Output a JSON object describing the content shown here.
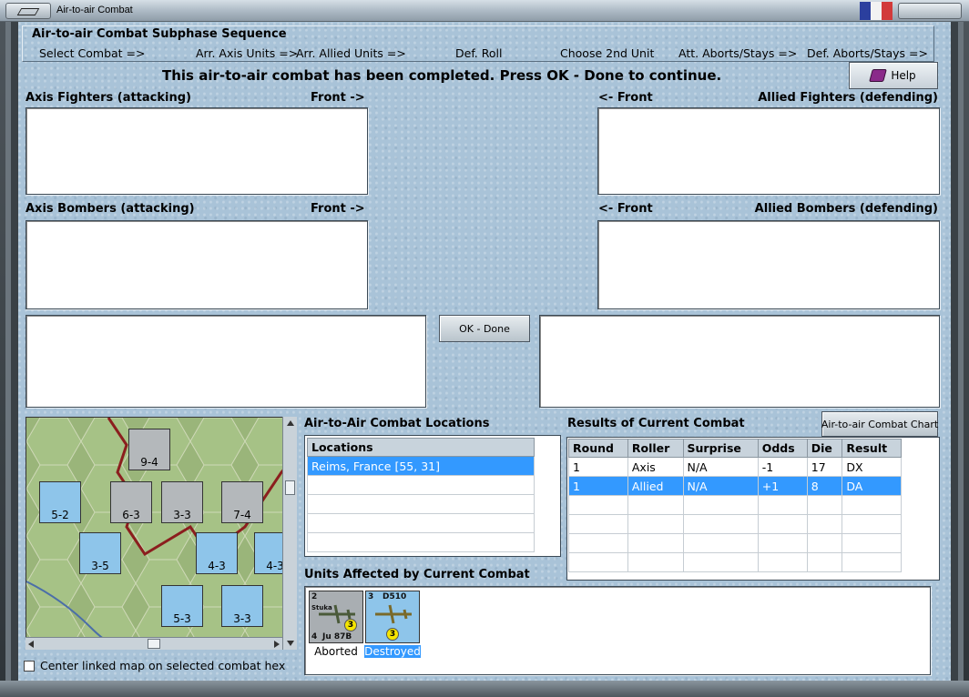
{
  "window": {
    "title": "Air-to-air Combat",
    "flag_colors": [
      "#2b3f9e",
      "#f2f2f2",
      "#d23a3a"
    ]
  },
  "sequence": {
    "title": "Air-to-air Combat Subphase Sequence",
    "steps": [
      "Select Combat =>",
      "Arr. Axis Units =>",
      "Arr. Allied Units =>",
      "Def. Roll",
      "Choose 2nd Unit",
      "Att. Aborts/Stays =>",
      "Def. Aborts/Stays =>"
    ]
  },
  "status_message": "This air-to-air combat has been completed.  Press OK - Done to continue.",
  "help_label": "Help",
  "boxes": {
    "axis_fighters": "Axis Fighters (attacking)",
    "allied_fighters": "Allied Fighters (defending)",
    "axis_bombers": "Axis Bombers (attacking)",
    "allied_bombers": "Allied Bombers (defending)",
    "front_right": "Front ->",
    "front_left": "<- Front"
  },
  "ok_label": "OK - Done",
  "locations": {
    "title": "Air-to-Air Combat Locations",
    "header": "Locations",
    "rows": [
      "Reims, France [55, 31]"
    ]
  },
  "results": {
    "title": "Results of Current Combat",
    "chart_button": "Air-to-air Combat Chart",
    "headers": [
      "Round",
      "Roller",
      "Surprise",
      "Odds",
      "Die",
      "Result"
    ],
    "rows": [
      [
        "1",
        "Axis",
        "N/A",
        "-1",
        "17",
        "DX"
      ],
      [
        "1",
        "Allied",
        "N/A",
        "+1",
        "8",
        "DA"
      ]
    ]
  },
  "units_affected": {
    "title": "Units Affected by Current Combat",
    "units": [
      {
        "top_left": "2",
        "name": "Ju 87B",
        "sub": "Stuka",
        "bottom_left": "4",
        "badge": "3",
        "caption": "Aborted",
        "color": "#a9aeb2"
      },
      {
        "top_left": "3",
        "name": "D510",
        "sub": "",
        "bottom_left": "",
        "badge": "3",
        "caption": "Destroyed",
        "color": "#8ec5ea"
      }
    ]
  },
  "center_map_label": "Center linked map on selected combat hex",
  "map": {
    "counters": [
      {
        "txt": "9-4",
        "color": "#b4b8bb"
      },
      {
        "txt": "6-3",
        "color": "#b4b8bb"
      },
      {
        "txt": "5-2",
        "color": "#8ec5ea"
      },
      {
        "txt": "3-3",
        "color": "#b4b8bb"
      },
      {
        "txt": "7-4",
        "color": "#b4b8bb"
      },
      {
        "txt": "3-5",
        "color": "#8ec5ea"
      },
      {
        "txt": "4-3",
        "color": "#8ec5ea"
      },
      {
        "txt": "5-3",
        "color": "#8ec5ea"
      },
      {
        "txt": "3-3",
        "color": "#8ec5ea"
      },
      {
        "txt": "4-3",
        "color": "#8ec5ea"
      }
    ]
  }
}
